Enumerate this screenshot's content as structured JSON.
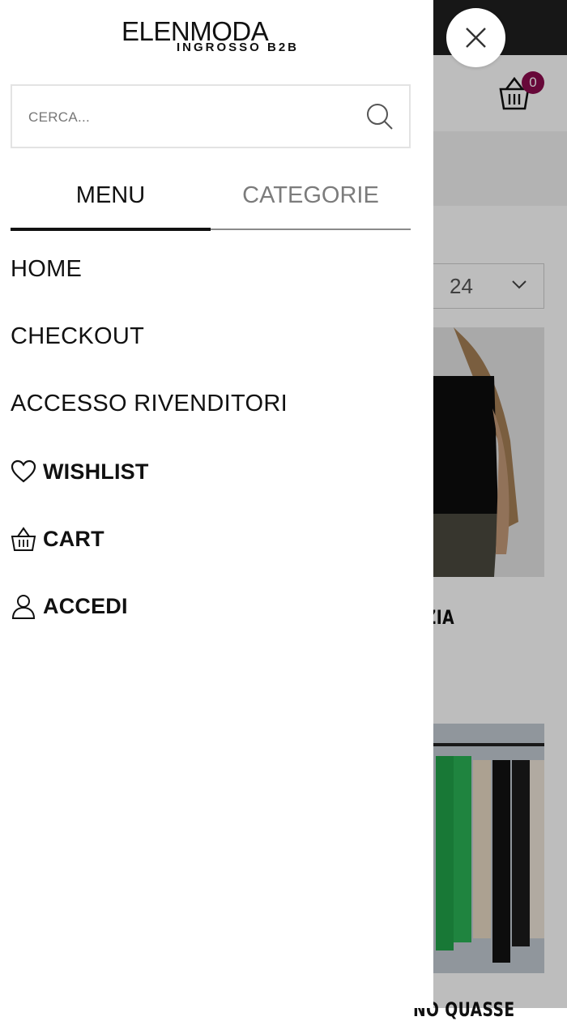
{
  "logo": {
    "main": "ELENMODA",
    "sub": "INGROSSO B2B"
  },
  "search": {
    "placeholder": "CERCA..."
  },
  "tabs": {
    "menu": "MENU",
    "categories": "CATEGORIE"
  },
  "menu": {
    "items": [
      "HOME",
      "CHECKOUT",
      "ACCESSO RIVENDITORI"
    ],
    "wishlist": "WISHLIST",
    "cart": "CART",
    "login": "ACCEDI"
  },
  "background": {
    "cart_count": "0",
    "per_page": "24",
    "product_title_1": "RZIA",
    "product_title_2": "NO QUASSE"
  },
  "colors": {
    "accent_badge": "#8c0b4e",
    "topbar": "#1f1f1f",
    "text": "#111111"
  }
}
